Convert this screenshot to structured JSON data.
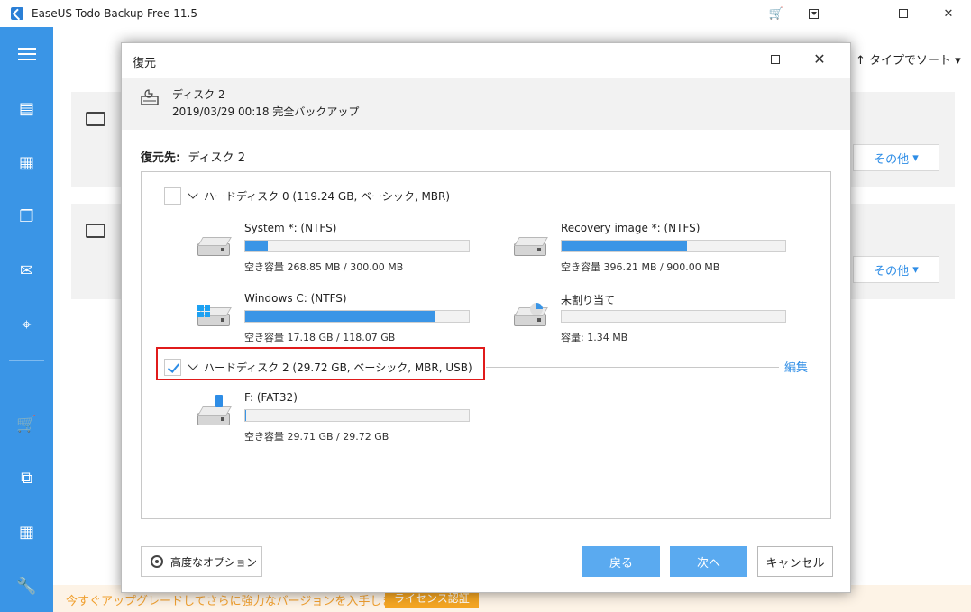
{
  "app": {
    "title": "EaseUS Todo Backup Free 11.5",
    "sort_label": "タイプでソート",
    "other_label": "その他",
    "upgrade_text": "今すぐアップグレードしてさらに強力なバージョンを入手しましょう。",
    "license_label": "ライセンス認証"
  },
  "dialog": {
    "title": "復元",
    "source": {
      "title": "ディスク 2",
      "subtitle": "2019/03/29 00:18 完全バックアップ"
    },
    "dest_prefix": "復元先:",
    "dest_value": "ディスク 2",
    "disks": [
      {
        "label": "ハードディスク 0 (119.24 GB, ベーシック, MBR)",
        "checked": false,
        "partitions": [
          {
            "name": "System *: (NTFS)",
            "info": "空き容量 268.85 MB / 300.00 MB",
            "used_fraction": 0.1,
            "icon": "hdd-icon"
          },
          {
            "name": "Recovery image *: (NTFS)",
            "info": "空き容量 396.21 MB / 900.00 MB",
            "used_fraction": 0.56,
            "icon": "hdd-icon"
          },
          {
            "name": "Windows C: (NTFS)",
            "info": "空き容量 17.18 GB / 118.07 GB",
            "used_fraction": 0.85,
            "icon": "windows-drive-icon"
          },
          {
            "name": "未割り当て",
            "info": "容量: 1.34 MB",
            "used_fraction": 0.0,
            "icon": "unallocated-drive-icon"
          }
        ]
      },
      {
        "label": "ハードディスク 2 (29.72 GB, ベーシック, MBR, USB)",
        "checked": true,
        "edit_label": "編集",
        "partitions": [
          {
            "name": "F: (FAT32)",
            "info": "空き容量 29.71 GB / 29.72 GB",
            "used_fraction": 0.005,
            "icon": "usb-drive-icon"
          }
        ]
      }
    ],
    "buttons": {
      "advanced": "高度なオプション",
      "back": "戻る",
      "next": "次へ",
      "cancel": "キャンセル"
    }
  },
  "colors": {
    "accent": "#3a95e6",
    "highlight": "#e01b1b",
    "link": "#2e8de6"
  }
}
